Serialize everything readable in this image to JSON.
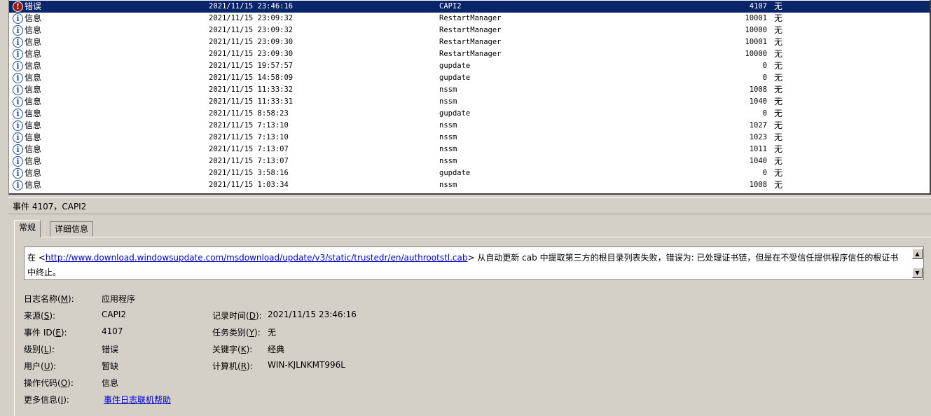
{
  "events": [
    {
      "level": "错误",
      "icon": "error-icon",
      "datetime": "2021/11/15 23:46:16",
      "source": "CAPI2",
      "event_id": "4107",
      "category": "无",
      "selected": true
    },
    {
      "level": "信息",
      "icon": "info-icon",
      "datetime": "2021/11/15 23:09:32",
      "source": "RestartManager",
      "event_id": "10001",
      "category": "无"
    },
    {
      "level": "信息",
      "icon": "info-icon",
      "datetime": "2021/11/15 23:09:32",
      "source": "RestartManager",
      "event_id": "10000",
      "category": "无"
    },
    {
      "level": "信息",
      "icon": "info-icon",
      "datetime": "2021/11/15 23:09:30",
      "source": "RestartManager",
      "event_id": "10001",
      "category": "无"
    },
    {
      "level": "信息",
      "icon": "info-icon",
      "datetime": "2021/11/15 23:09:30",
      "source": "RestartManager",
      "event_id": "10000",
      "category": "无"
    },
    {
      "level": "信息",
      "icon": "info-icon",
      "datetime": "2021/11/15 19:57:57",
      "source": "gupdate",
      "event_id": "0",
      "category": "无"
    },
    {
      "level": "信息",
      "icon": "info-icon",
      "datetime": "2021/11/15 14:58:09",
      "source": "gupdate",
      "event_id": "0",
      "category": "无"
    },
    {
      "level": "信息",
      "icon": "info-icon",
      "datetime": "2021/11/15 11:33:32",
      "source": "nssm",
      "event_id": "1008",
      "category": "无"
    },
    {
      "level": "信息",
      "icon": "info-icon",
      "datetime": "2021/11/15 11:33:31",
      "source": "nssm",
      "event_id": "1040",
      "category": "无"
    },
    {
      "level": "信息",
      "icon": "info-icon",
      "datetime": "2021/11/15 8:58:23",
      "source": "gupdate",
      "event_id": "0",
      "category": "无"
    },
    {
      "level": "信息",
      "icon": "info-icon",
      "datetime": "2021/11/15 7:13:10",
      "source": "nssm",
      "event_id": "1027",
      "category": "无"
    },
    {
      "level": "信息",
      "icon": "info-icon",
      "datetime": "2021/11/15 7:13:10",
      "source": "nssm",
      "event_id": "1023",
      "category": "无"
    },
    {
      "level": "信息",
      "icon": "info-icon",
      "datetime": "2021/11/15 7:13:07",
      "source": "nssm",
      "event_id": "1011",
      "category": "无"
    },
    {
      "level": "信息",
      "icon": "info-icon",
      "datetime": "2021/11/15 7:13:07",
      "source": "nssm",
      "event_id": "1040",
      "category": "无"
    },
    {
      "level": "信息",
      "icon": "info-icon",
      "datetime": "2021/11/15 3:58:16",
      "source": "gupdate",
      "event_id": "0",
      "category": "无"
    },
    {
      "level": "信息",
      "icon": "info-icon",
      "datetime": "2021/11/15 1:03:34",
      "source": "nssm",
      "event_id": "1008",
      "category": "无"
    }
  ],
  "detail": {
    "header": "事件 4107，CAPI2",
    "tabs": {
      "general": "常规",
      "details": "详细信息"
    },
    "description": {
      "prefix": "在 <",
      "url": "http://www.download.windowsupdate.com/msdownload/update/v3/static/trustedr/en/authrootstl.cab",
      "suffix": "> 从自动更新 cab 中提取第三方的根目录列表失败，错误为: 已处理证书链，但是在不受信任提供程序信任的根证书中终止。"
    },
    "fields": {
      "log_name": {
        "label": "日志名称(",
        "key": "M",
        "end": "):",
        "value": "应用程序"
      },
      "source": {
        "label": "来源(",
        "key": "S",
        "end": "):",
        "value": "CAPI2"
      },
      "logged": {
        "label": "记录时间(",
        "key": "D",
        "end": "):",
        "value": "2021/11/15 23:46:16"
      },
      "event_id": {
        "label": "事件 ID(",
        "key": "E",
        "end": "):",
        "value": "4107"
      },
      "task_category": {
        "label": "任务类别(",
        "key": "Y",
        "end": "):",
        "value": "无"
      },
      "level": {
        "label": "级别(",
        "key": "L",
        "end": "):",
        "value": "错误"
      },
      "keywords": {
        "label": "关键字(",
        "key": "K",
        "end": "):",
        "value": "经典"
      },
      "user": {
        "label": "用户(",
        "key": "U",
        "end": "):",
        "value": "暂缺"
      },
      "computer": {
        "label": "计算机(",
        "key": "R",
        "end": "):",
        "value": "WIN-KJLNKMT996L"
      },
      "opcode": {
        "label": "操作代码(",
        "key": "O",
        "end": "):",
        "value": "信息"
      },
      "more_info": {
        "label": "更多信息(",
        "key": "I",
        "end": "):",
        "value": "事件日志联机帮助"
      }
    }
  }
}
